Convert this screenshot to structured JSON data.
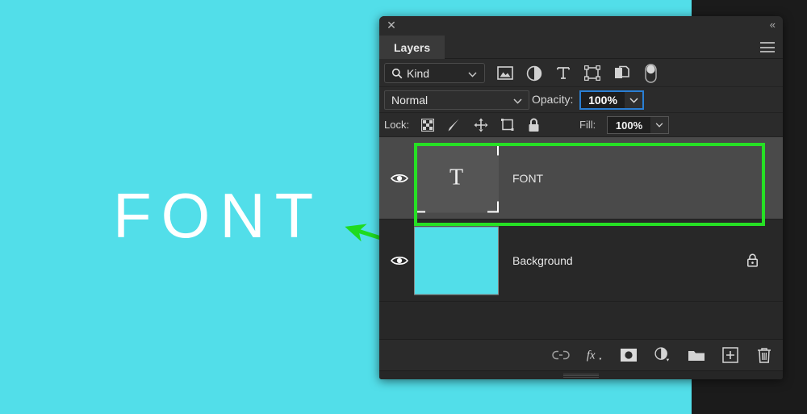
{
  "canvas": {
    "background_color": "#52dee9",
    "artboard_text": "FONT",
    "text_color": "#ffffff"
  },
  "annotation": {
    "arrow_color": "#1fdb1f",
    "target": "FONT"
  },
  "panel": {
    "title": "Layers",
    "close_icon": "close-icon",
    "collapse_icon": "double-chevron-left-icon",
    "menu_icon": "hamburger-menu-icon",
    "filter": {
      "kind_label": "Kind",
      "search_icon": "search-icon",
      "caret_icon": "chevron-down-icon",
      "icons": [
        {
          "name": "filter-pixel-layers-icon",
          "glyph": "image"
        },
        {
          "name": "filter-adjustment-layers-icon",
          "glyph": "half-circle"
        },
        {
          "name": "filter-type-layers-icon",
          "glyph": "T"
        },
        {
          "name": "filter-shape-layers-icon",
          "glyph": "shape"
        },
        {
          "name": "filter-smart-object-icon",
          "glyph": "smart-object"
        },
        {
          "name": "filter-toggle-switch",
          "glyph": "toggle"
        }
      ]
    },
    "blend": {
      "mode": "Normal",
      "opacity_label": "Opacity:",
      "opacity_value": "100%",
      "opacity_border_color": "#2a7fd4"
    },
    "lock": {
      "label": "Lock:",
      "icons": [
        {
          "name": "lock-transparent-pixels-icon"
        },
        {
          "name": "lock-image-pixels-icon"
        },
        {
          "name": "lock-position-icon"
        },
        {
          "name": "lock-artboard-nesting-icon"
        },
        {
          "name": "lock-all-icon"
        }
      ],
      "fill_label": "Fill:",
      "fill_value": "100%"
    },
    "layers": [
      {
        "name": "FONT",
        "type": "text",
        "visible": true,
        "selected": true,
        "thumb_glyph": "T",
        "locked": false,
        "highlight_color": "#26e024"
      },
      {
        "name": "Background",
        "type": "solid",
        "visible": true,
        "selected": false,
        "thumb_color": "#52dee9",
        "locked": true
      }
    ],
    "bottom_toolbar": [
      {
        "name": "link-layers-icon"
      },
      {
        "name": "layer-style-fx-icon",
        "label": "fx"
      },
      {
        "name": "add-layer-mask-icon"
      },
      {
        "name": "new-adjustment-layer-icon"
      },
      {
        "name": "new-group-icon"
      },
      {
        "name": "new-layer-icon"
      },
      {
        "name": "delete-layer-icon"
      }
    ]
  }
}
